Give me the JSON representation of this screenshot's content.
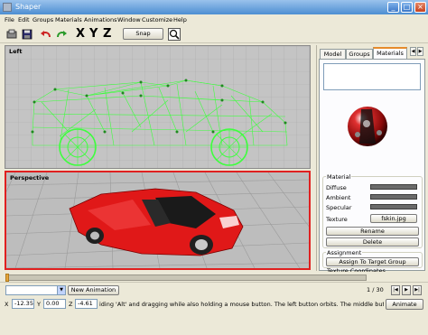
{
  "window": {
    "title": "Shaper",
    "min_glyph": "_",
    "max_glyph": "□",
    "close_glyph": "×"
  },
  "menu": [
    "File",
    "Edit",
    "Groups",
    "Materials",
    "Animations",
    "Window",
    "Customize",
    "Help"
  ],
  "toolbar": {
    "axis_x": "X",
    "axis_y": "Y",
    "axis_z": "Z",
    "snap_label": "Snap"
  },
  "viewports": {
    "left_label": "Left",
    "perspective_label": "Perspective"
  },
  "panel": {
    "tabs": [
      "Model",
      "Groups",
      "Materials"
    ],
    "active_tab": "Materials",
    "material_group_title": "Material",
    "properties": [
      {
        "label": "Diffuse",
        "color": "#6a6a6a"
      },
      {
        "label": "Ambient",
        "color": "#6a6a6a"
      },
      {
        "label": "Specular",
        "color": "#6a6a6a"
      }
    ],
    "texture_label": "Texture",
    "texture_file": "fskin.jpg",
    "rename_label": "Rename",
    "delete_label": "Delete",
    "assignment_title": "Assignment",
    "assign_label": "Assign To Target Group",
    "texture_coords_title": "Texture Coordinates"
  },
  "timeline": {
    "frame_display": "1 / 30",
    "position_fraction": 0.0
  },
  "animation": {
    "selected": "",
    "new_label": "New Animation ...",
    "arrow_glyph": "▼"
  },
  "playback": {
    "rewind": "|◀",
    "play": "▶",
    "forward": "▶|"
  },
  "status": {
    "x_label": "X",
    "x_value": "-12.35",
    "y_label": "Y",
    "y_value": "0.00",
    "z_label": "Z",
    "z_value": "-4.61",
    "help": "iding 'Alt' and dragging while also holding a mouse button. The left button orbits. The middle button pans. The right button zooms.",
    "animate_label": "Animate"
  },
  "colors": {
    "title_blue": "#3c78c8",
    "wire_green": "#3dff3d",
    "car_red": "#e01818",
    "active_border": "#e02020",
    "tab_highlight": "#e68b2c"
  }
}
